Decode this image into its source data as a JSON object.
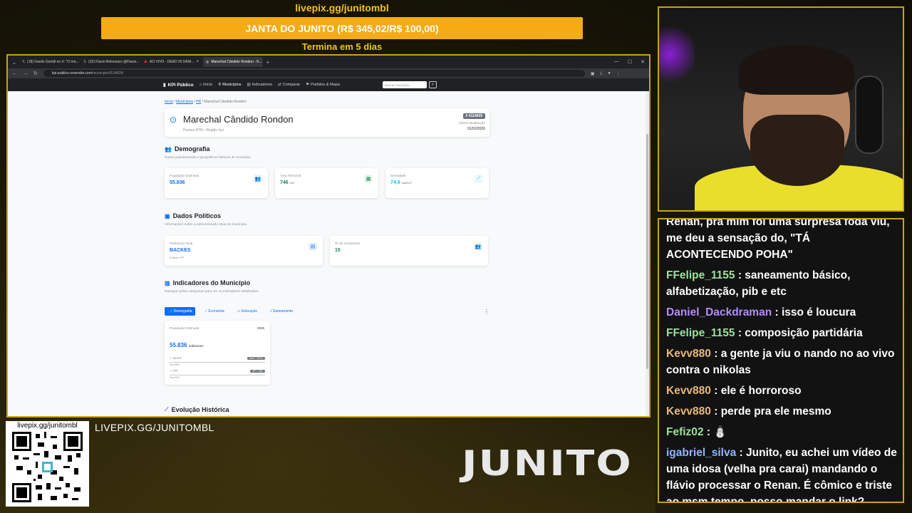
{
  "donation": {
    "link": "livepix.gg/junitombl",
    "goal": "JANTA DO JUNITO (R$ 345,02/R$ 100,00)",
    "ends": "Termina em 5 dias"
  },
  "browser": {
    "tabs": [
      {
        "label": "(18) Danilo Gentili no X: \"O me..."
      },
      {
        "label": "(32) Flavio Bolsonaro @Flavio..."
      },
      {
        "label": "AO VIVO - DEAD IN DANI..."
      },
      {
        "label": "Marechal Cândido Rondon - K..."
      }
    ],
    "url_domain": "kpi-publico.onrender.com",
    "url_path": "/municipio/4114609/"
  },
  "site": {
    "brand": "KPI Público",
    "nav": [
      "Início",
      "Municípios",
      "Indicadores",
      "Comparar",
      "Partidos & Mapa"
    ],
    "search_placeholder": "Buscar município...",
    "breadcrumb": [
      "Início",
      "Municípios",
      "PR",
      "Marechal Cândido Rondon"
    ],
    "city": "Marechal Cândido Rondon",
    "city_sub": "Paraná (PR) • Região Sul",
    "code": "# 4114609",
    "update_label": "Última atualização",
    "update_date": "01/02/2026",
    "demografia": {
      "title": "Demografia",
      "desc": "Dados populacionais e geográficos básicos do município.",
      "cards": [
        {
          "label": "População Estimada",
          "value": "55.836",
          "unit": ""
        },
        {
          "label": "Área Territorial",
          "value": "746",
          "unit": "km²"
        },
        {
          "label": "Densidade",
          "value": "74,9",
          "unit": "hab/km²"
        }
      ]
    },
    "politicos": {
      "title": "Dados Políticos",
      "desc": "Informações sobre a administração atual do município.",
      "cards": [
        {
          "label": "Prefeito(a) Atual",
          "value": "BACKES",
          "foot": "Partido: PP"
        },
        {
          "label": "Nº de Vereadores",
          "value": "15",
          "foot": ""
        }
      ]
    },
    "indicadores": {
      "title": "Indicadores do Município",
      "desc": "Navegue pelas categorias para ver os indicadores detalhados.",
      "tabs": [
        "Demografia",
        "Economia",
        "Educação",
        "Saneamento"
      ],
      "card": {
        "label": "População Estimada",
        "year": "2025",
        "value": "55.836",
        "unit": "habitantes",
        "rank1_label": "Brasil",
        "rank1_badge": "549º / 5570",
        "rank1_sub": "Top 90%",
        "rank2_label": "PR",
        "rank2_badge": "32º / 399",
        "rank2_sub": "Top 92%"
      }
    },
    "evolucao_title": "Evolução Histórica"
  },
  "overlay": {
    "qr_label": "livepix.gg/junitombl",
    "livepix_caps": "LIVEPIX.GG/JUNITOMBL",
    "logo": "JUNITO"
  },
  "chat": [
    {
      "user": "",
      "color": "#ffffff",
      "text": "Renan, pra mim foi uma surpresa foda viu, me deu a sensação do, \"TÁ ACONTECENDO POHA\""
    },
    {
      "user": "FFelipe_1155",
      "color": "#9ae39a",
      "text": ": saneamento básico, alfabetização, pib e etc"
    },
    {
      "user": "Daniel_Dackdraman",
      "color": "#b38cff",
      "text": ": isso é loucura"
    },
    {
      "user": "FFelipe_1155",
      "color": "#9ae39a",
      "text": ": composição partidária"
    },
    {
      "user": "Kevv880",
      "color": "#e8b97a",
      "text": ": a gente ja viu o nando no ao vivo contra o nikolas"
    },
    {
      "user": "Kevv880",
      "color": "#e8b97a",
      "text": ": ele é horroroso"
    },
    {
      "user": "Kevv880",
      "color": "#e8b97a",
      "text": ": perde pra ele mesmo"
    },
    {
      "user": "Fefiz02",
      "color": "#9ae39a",
      "text": ": ⛄"
    },
    {
      "user": "igabriel_silva",
      "color": "#8fb8ff",
      "text": ": Junito, eu achei um vídeo de uma idosa (velha pra carai) mandando o flávio processar o Renan. É cômico e triste ao msm tempo, posso mandar o link?"
    }
  ]
}
